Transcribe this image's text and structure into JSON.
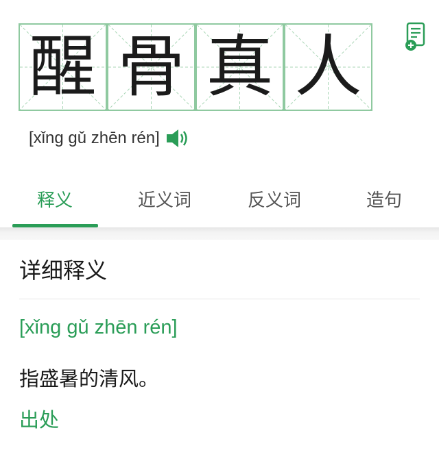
{
  "header": {
    "characters": [
      "醒",
      "骨",
      "真",
      "人"
    ],
    "pinyin": "[xǐng gǔ zhēn rén]",
    "note_icon": "note-add-icon",
    "speaker_icon": "speaker-icon"
  },
  "tabs": [
    {
      "label": "释义",
      "active": true
    },
    {
      "label": "近义词",
      "active": false
    },
    {
      "label": "反义词",
      "active": false
    },
    {
      "label": "造句",
      "active": false
    }
  ],
  "detail": {
    "title": "详细释义",
    "pinyin": "[xǐng gǔ zhēn rén]",
    "definition": "指盛暑的清风。",
    "source_heading": "出处"
  },
  "colors": {
    "accent": "#2a9d57",
    "grid": "#8fc9a0",
    "text": "#1a1a1a"
  }
}
